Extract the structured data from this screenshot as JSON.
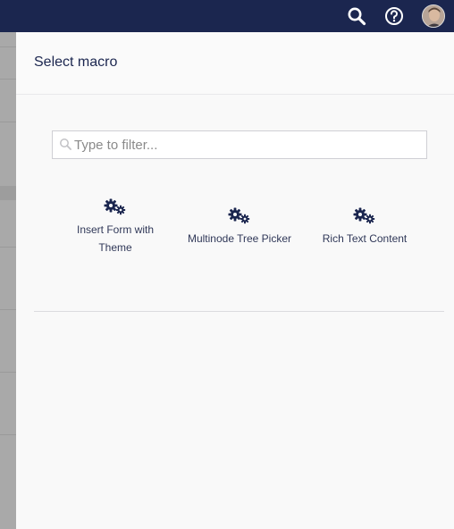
{
  "topbar": {
    "icons": [
      "search-icon",
      "help-icon",
      "avatar"
    ]
  },
  "panel": {
    "title": "Select macro",
    "filter": {
      "placeholder": "Type to filter...",
      "value": ""
    },
    "macros": [
      {
        "label": "Insert Form with Theme",
        "icon": "gears-icon"
      },
      {
        "label": "Multinode Tree Picker",
        "icon": "gears-icon"
      },
      {
        "label": "Rich Text Content",
        "icon": "gears-icon"
      }
    ]
  },
  "colors": {
    "topbar": "#1b264f",
    "accent": "#1b264f",
    "panel_bg": "#f9f9f9"
  }
}
